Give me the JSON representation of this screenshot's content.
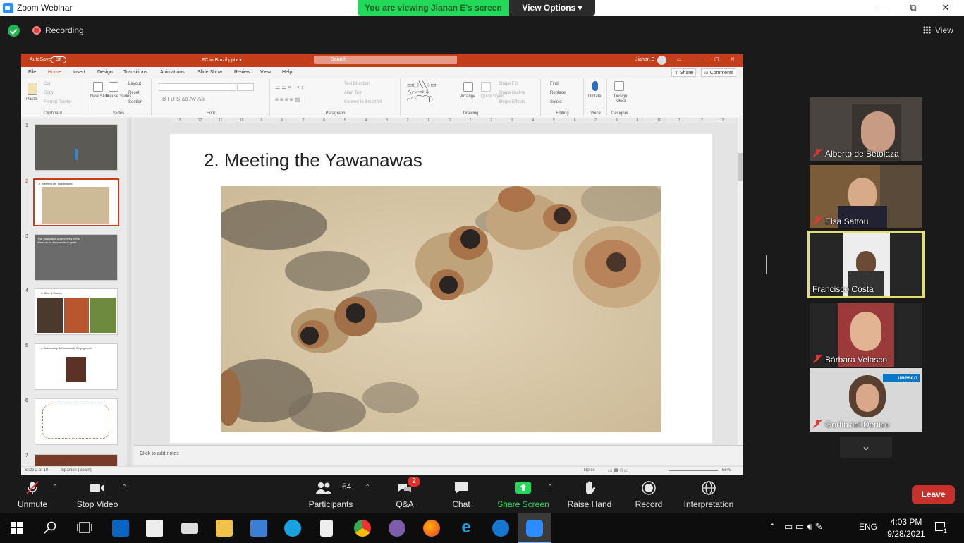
{
  "window": {
    "title": "Zoom Webinar",
    "minimize": "—",
    "maximize": "⧉",
    "close": "✕"
  },
  "banner": {
    "viewing": "You are viewing Jianan E's screen",
    "view_options": "View Options ▾"
  },
  "top": {
    "recording": "Recording",
    "view": "View"
  },
  "powerpoint": {
    "autosave": "AutoSave",
    "autosave_state": "Off",
    "filename": "FC in Brazil.pptx ▾",
    "search": "Search",
    "user": "Jianan E",
    "share": "Share",
    "comments": "Comments",
    "menu": [
      "File",
      "Home",
      "Insert",
      "Design",
      "Transitions",
      "Animations",
      "Slide Show",
      "Review",
      "View",
      "Help"
    ],
    "ribbon_groups": [
      "Clipboard",
      "Slides",
      "Font",
      "Paragraph",
      "Drawing",
      "Editing",
      "Voice",
      "Designer"
    ],
    "ribbon": {
      "paste": "Paste",
      "cut": "Cut",
      "copy": "Copy",
      "format_painter": "Format Painter",
      "new_slide": "New Slide",
      "reuse_slides": "Reuse Slides",
      "layout": "Layout",
      "reset": "Reset",
      "section": "Section",
      "text_direction": "Text Direction",
      "align_text": "Align Text",
      "convert_smartart": "Convert to SmartArt",
      "arrange": "Arrange",
      "quick_styles": "Quick Styles",
      "shape_fill": "Shape Fill",
      "shape_outline": "Shape Outline",
      "shape_effects": "Shape Effects",
      "find": "Find",
      "replace": "Replace",
      "select": "Select",
      "dictate": "Dictate",
      "design_ideas": "Design Ideas"
    },
    "thumbnails": [
      {
        "num": "1",
        "title": ""
      },
      {
        "num": "2",
        "title": "2. Meeting the Yawanawas"
      },
      {
        "num": "3",
        "title": "The Yawanawa's have lived in the Amazon for thousands of years"
      },
      {
        "num": "4",
        "title": "3. Bino & Cacury"
      },
      {
        "num": "5",
        "title": "4. Artisanship & Community Engagement"
      },
      {
        "num": "6",
        "title": ""
      },
      {
        "num": "7",
        "title": ""
      }
    ],
    "slide_title": "2.  Meeting the Yawanawas",
    "notes_placeholder": "Click to add notes",
    "status": {
      "slide": "Slide 2 of 10",
      "language": "Spanish (Spain)",
      "notes": "Notes",
      "zoom": "55%"
    },
    "ruler_ticks": [
      "13",
      "12",
      "11",
      "10",
      "9",
      "8",
      "7",
      "6",
      "5",
      "4",
      "3",
      "2",
      "1",
      "0",
      "1",
      "2",
      "3",
      "4",
      "5",
      "6",
      "7",
      "8",
      "9",
      "10",
      "11",
      "12",
      "13"
    ]
  },
  "participants_gallery": [
    {
      "name": "Alberto de Betolaza",
      "muted": true
    },
    {
      "name": "Elsa Sattou",
      "muted": true
    },
    {
      "name": "Francisco Costa",
      "muted": false,
      "active_speaker": true
    },
    {
      "name": "Bárbara Velasco",
      "muted": true
    },
    {
      "name": "Gorfinkiel Denise",
      "muted": true,
      "logo": "unesco"
    }
  ],
  "toolbar": {
    "unmute": "Unmute",
    "stop_video": "Stop Video",
    "participants": "Participants",
    "participants_count": "64",
    "qa": "Q&A",
    "qa_badge": "2",
    "chat": "Chat",
    "share_screen": "Share Screen",
    "raise_hand": "Raise Hand",
    "record": "Record",
    "interpretation": "Interpretation",
    "leave": "Leave"
  },
  "taskbar": {
    "time": "4:03 PM",
    "date": "9/28/2021",
    "lang": "ENG",
    "notifications": "1"
  },
  "colors": {
    "ppt_red": "#c43e1c",
    "zoom_green": "#23d959",
    "leave_red": "#c8302c",
    "speaker_border": "#e0e070"
  }
}
